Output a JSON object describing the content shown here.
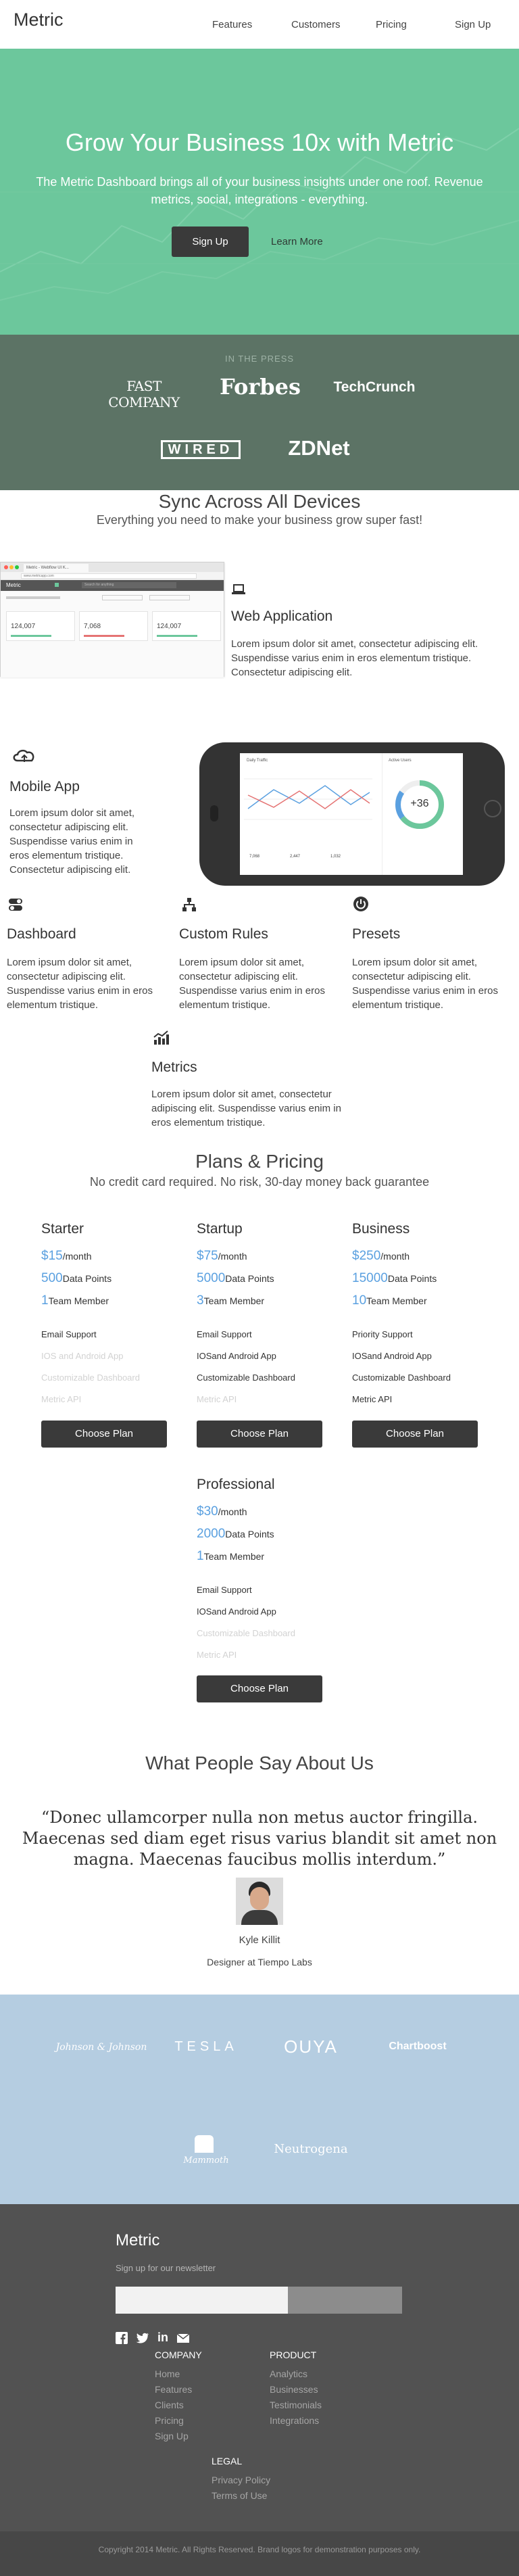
{
  "nav": {
    "logo": "Metric",
    "links": [
      "Features",
      "Customers",
      "Pricing",
      "Sign Up"
    ]
  },
  "hero": {
    "title": "Grow Your Business 10x with Metric",
    "subtitle": "The Metric Dashboard brings all of your business insights under one roof. Revenue metrics, social, integrations - everything.",
    "primary_button": "Sign Up",
    "secondary_link": "Learn More",
    "bg_color": "#6cc79c"
  },
  "press": {
    "label": "IN THE PRESS",
    "logos": [
      "FAST COMPANY",
      "Forbes",
      "TechCrunch",
      "WIRED",
      "ZDNet"
    ]
  },
  "sync": {
    "title": "Sync Across All Devices",
    "subtitle": "Everything you need to make your business grow super fast!"
  },
  "web_app": {
    "icon": "laptop-icon",
    "title": "Web Application",
    "text": "Lorem ipsum dolor sit amet, consectetur adipiscing elit. Suspendisse varius enim in eros elementum tristique. Consectetur adipiscing elit.",
    "mock": {
      "tab": "Metric - Webflow UI K...",
      "url": "www.metricapp.com",
      "brand": "Metric",
      "search": "Search for anything",
      "stats": [
        "124,007",
        "7,068",
        "124,007"
      ]
    }
  },
  "mobile_app": {
    "icon": "cloud-icon",
    "title": "Mobile App",
    "text": "Lorem ipsum dolor sit amet, consectetur adipiscing elit. Suspendisse varius enim in eros elementum tristique. Consectetur adipiscing elit.",
    "mock": {
      "chart_title": "Daily Traffic",
      "gauge_title": "Active Users",
      "gauge_value": "+36",
      "stats": [
        "7,068",
        "2,447",
        "1,032"
      ]
    }
  },
  "features": [
    {
      "icon": "toggle-icon",
      "title": "Dashboard",
      "text": "Lorem ipsum dolor sit amet, consectetur adipiscing elit. Suspendisse varius enim in eros elementum tristique."
    },
    {
      "icon": "network-icon",
      "title": "Custom Rules",
      "text": "Lorem ipsum dolor sit amet, consectetur adipiscing elit. Suspendisse varius enim in eros elementum tristique."
    },
    {
      "icon": "power-icon",
      "title": "Presets",
      "text": "Lorem ipsum dolor sit amet, consectetur adipiscing elit. Suspendisse varius enim in eros elementum tristique."
    },
    {
      "icon": "bar-chart-icon",
      "title": "Metrics",
      "text": "Lorem ipsum dolor sit amet, consectetur adipiscing elit. Suspendisse varius enim in eros elementum tristique."
    }
  ],
  "pricing": {
    "title": "Plans & Pricing",
    "subtitle": "No credit card required. No risk, 30-day money back guarantee",
    "button": "Choose Plan",
    "plans": [
      {
        "name": "Starter",
        "price": "$15",
        "price_unit": "/month",
        "points": "500",
        "points_label": "Data Points",
        "members": "1",
        "members_label": "Team Member",
        "features": [
          {
            "t": "Email Support",
            "on": true
          },
          {
            "t": "IOS and Android App",
            "on": false
          },
          {
            "t": "Customizable Dashboard",
            "on": false
          },
          {
            "t": "Metric API",
            "on": false
          }
        ]
      },
      {
        "name": "Startup",
        "price": "$75",
        "price_unit": "/month",
        "points": "5000",
        "points_label": "Data Points",
        "members": "3",
        "members_label": "Team Member",
        "features": [
          {
            "t": "Email Support",
            "on": true
          },
          {
            "t": "IOSand  Android App",
            "on": true
          },
          {
            "t": "Customizable Dashboard",
            "on": true
          },
          {
            "t": "Metric API",
            "on": false
          }
        ]
      },
      {
        "name": "Business",
        "price": "$250",
        "price_unit": "/month",
        "points": "15000",
        "points_label": "Data Points",
        "members": "10",
        "members_label": "Team Member",
        "features": [
          {
            "t": "Priority Support",
            "on": true
          },
          {
            "t": "IOSand  Android App",
            "on": true
          },
          {
            "t": "Customizable Dashboard",
            "on": true
          },
          {
            "t": "Metric API",
            "on": true
          }
        ]
      },
      {
        "name": "Professional",
        "price": "$30",
        "price_unit": "/month",
        "points": "2000",
        "points_label": "Data Points",
        "members": "1",
        "members_label": "Team Member",
        "features": [
          {
            "t": "Email Support",
            "on": true
          },
          {
            "t": "IOSand  Android App",
            "on": true
          },
          {
            "t": "Customizable Dashboard",
            "on": false
          },
          {
            "t": "Metric API",
            "on": false
          }
        ]
      }
    ]
  },
  "testimonials": {
    "title": "What People Say About Us",
    "quote": "“Donec ullamcorper nulla non metus auctor fringilla. Maecenas sed diam eget risus varius blandit sit amet non magna. Maecenas faucibus mollis interdum.”",
    "name": "Kyle Killit",
    "role": "Designer at Tiempo Labs"
  },
  "clients": {
    "logos": [
      "Johnson & Johnson",
      "TESLA",
      "OUYA",
      "Chartboost",
      "Mammoth",
      "Neutrogena"
    ],
    "bg_color": "#b5cde1"
  },
  "footer": {
    "logo": "Metric",
    "newsletter_label": "Sign up for our newsletter",
    "email_value": "",
    "social": [
      "facebook-icon",
      "twitter-icon",
      "linkedin-icon",
      "mail-icon"
    ],
    "company_head": "COMPANY",
    "company_links": [
      "Home",
      "Features",
      "Clients",
      "Pricing",
      "Sign Up"
    ],
    "product_head": "PRODUCT",
    "product_links": [
      "Analytics",
      "Businesses",
      "Testimonials",
      "Integrations"
    ],
    "legal_head": "LEGAL",
    "legal_links": [
      "Privacy Policy",
      "Terms of Use"
    ],
    "copyright": "Copyright 2014 Metric. All Rights Reserved. Brand logos for demonstration purposes only."
  }
}
